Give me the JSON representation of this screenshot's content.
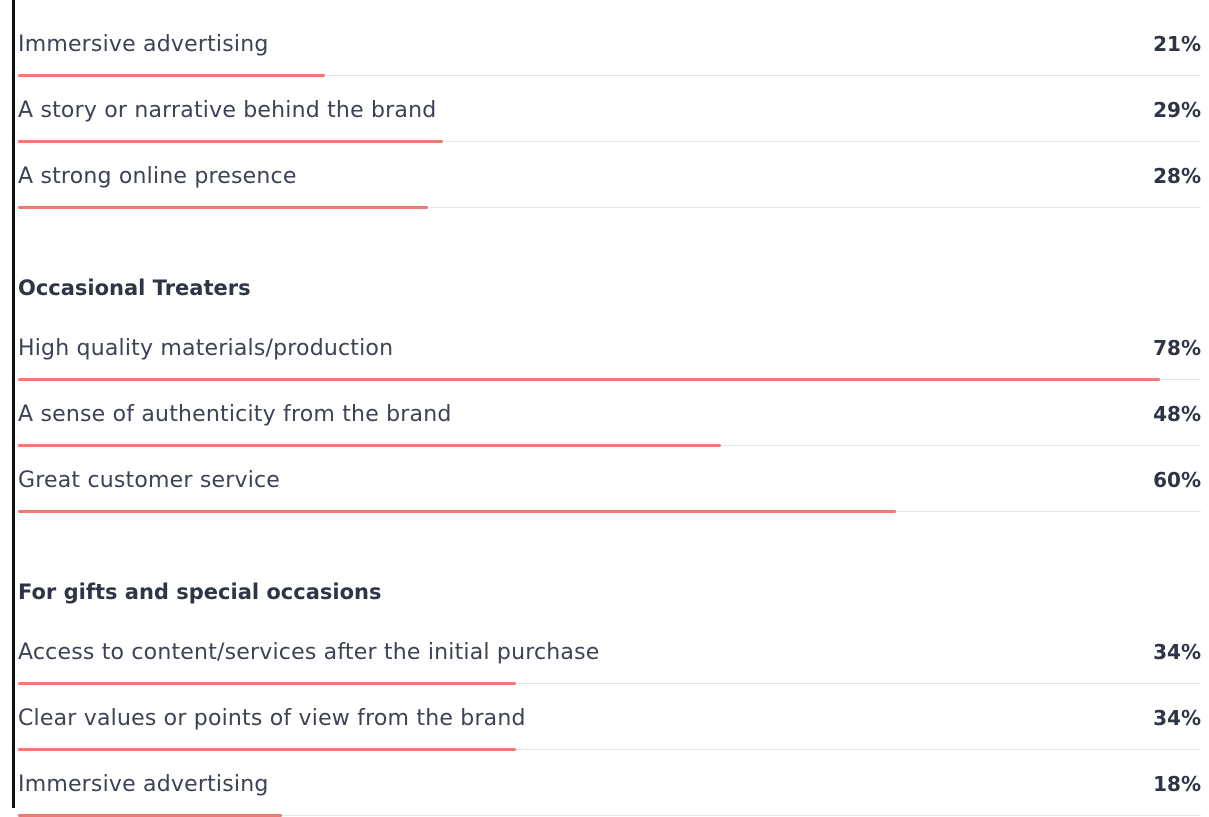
{
  "chart_data": {
    "type": "bar",
    "orientation": "horizontal",
    "xlim": [
      0,
      80
    ],
    "groups": [
      {
        "title": "",
        "items": [
          {
            "label": "Immersive advertising",
            "value": 21,
            "value_label": "21%"
          },
          {
            "label": "A story or narrative behind the brand",
            "value": 29,
            "value_label": "29%"
          },
          {
            "label": "A strong online presence",
            "value": 28,
            "value_label": "28%"
          }
        ]
      },
      {
        "title": "Occasional Treaters",
        "items": [
          {
            "label": "High quality materials/production",
            "value": 78,
            "value_label": "78%"
          },
          {
            "label": "A sense of authenticity from the brand",
            "value": 48,
            "value_label": "48%"
          },
          {
            "label": "Great customer service",
            "value": 60,
            "value_label": "60%"
          }
        ]
      },
      {
        "title": "For gifts and special occasions",
        "items": [
          {
            "label": "Access to content/services after the initial purchase",
            "value": 34,
            "value_label": "34%"
          },
          {
            "label": "Clear values or points of view from the brand",
            "value": 34,
            "value_label": "34%"
          },
          {
            "label": "Immersive advertising",
            "value": 18,
            "value_label": "18%"
          }
        ]
      }
    ],
    "colors": {
      "bar": "#ee7a73",
      "track": "#e4e6ec"
    }
  }
}
